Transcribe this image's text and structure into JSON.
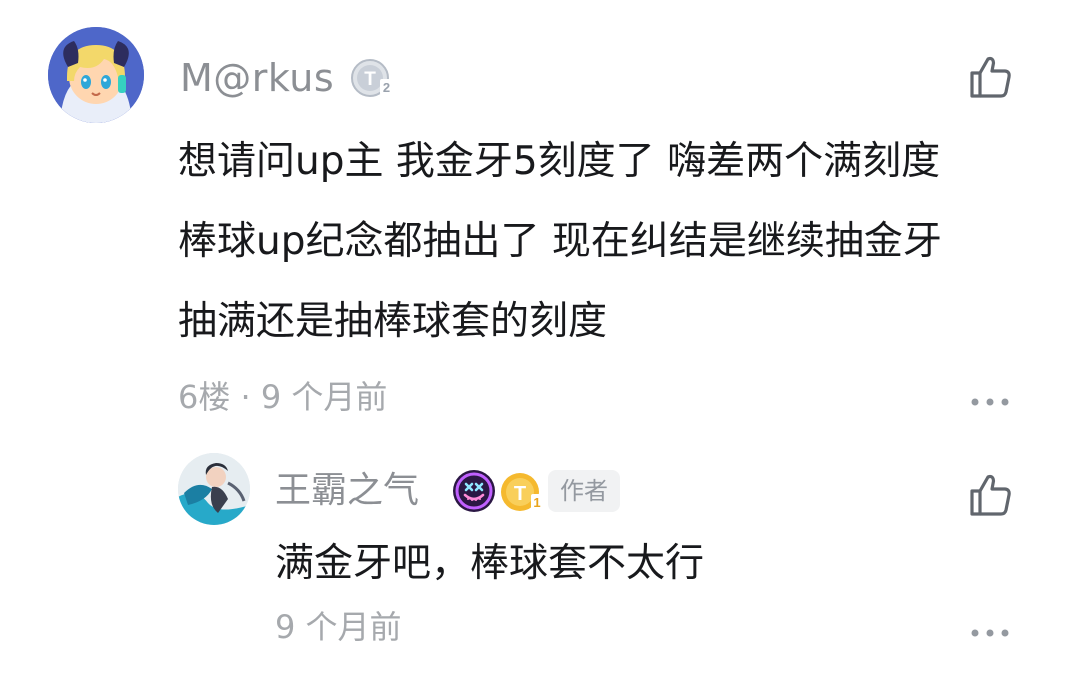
{
  "comment": {
    "username": "M@rkus",
    "level_badge": "T2",
    "text_lines": [
      "想请问up主 我金牙5刻度了 嗨差两个满刻度",
      "棒球up纪念都抽出了 现在纠结是继续抽金牙",
      "抽满还是抽棒球套的刻度"
    ],
    "meta": "6楼 · 9 个月前",
    "icons": {
      "like": "thumbs-up-icon",
      "more": "more-dots-icon"
    },
    "colors": {
      "username": "#8c8f94",
      "text": "#18191c",
      "meta": "#a6a9ad"
    }
  },
  "reply": {
    "username": "王霸之气",
    "level_badge": "T1",
    "author_tag": "作者",
    "text": "满金牙吧，棒球套不太行",
    "meta": "9 个月前",
    "icons": {
      "badge": "purple-skull-badge-icon",
      "like": "thumbs-up-icon",
      "more": "more-dots-icon"
    },
    "colors": {
      "level_badge": "#f5b92e",
      "author_tag_bg": "#f1f2f3"
    }
  }
}
